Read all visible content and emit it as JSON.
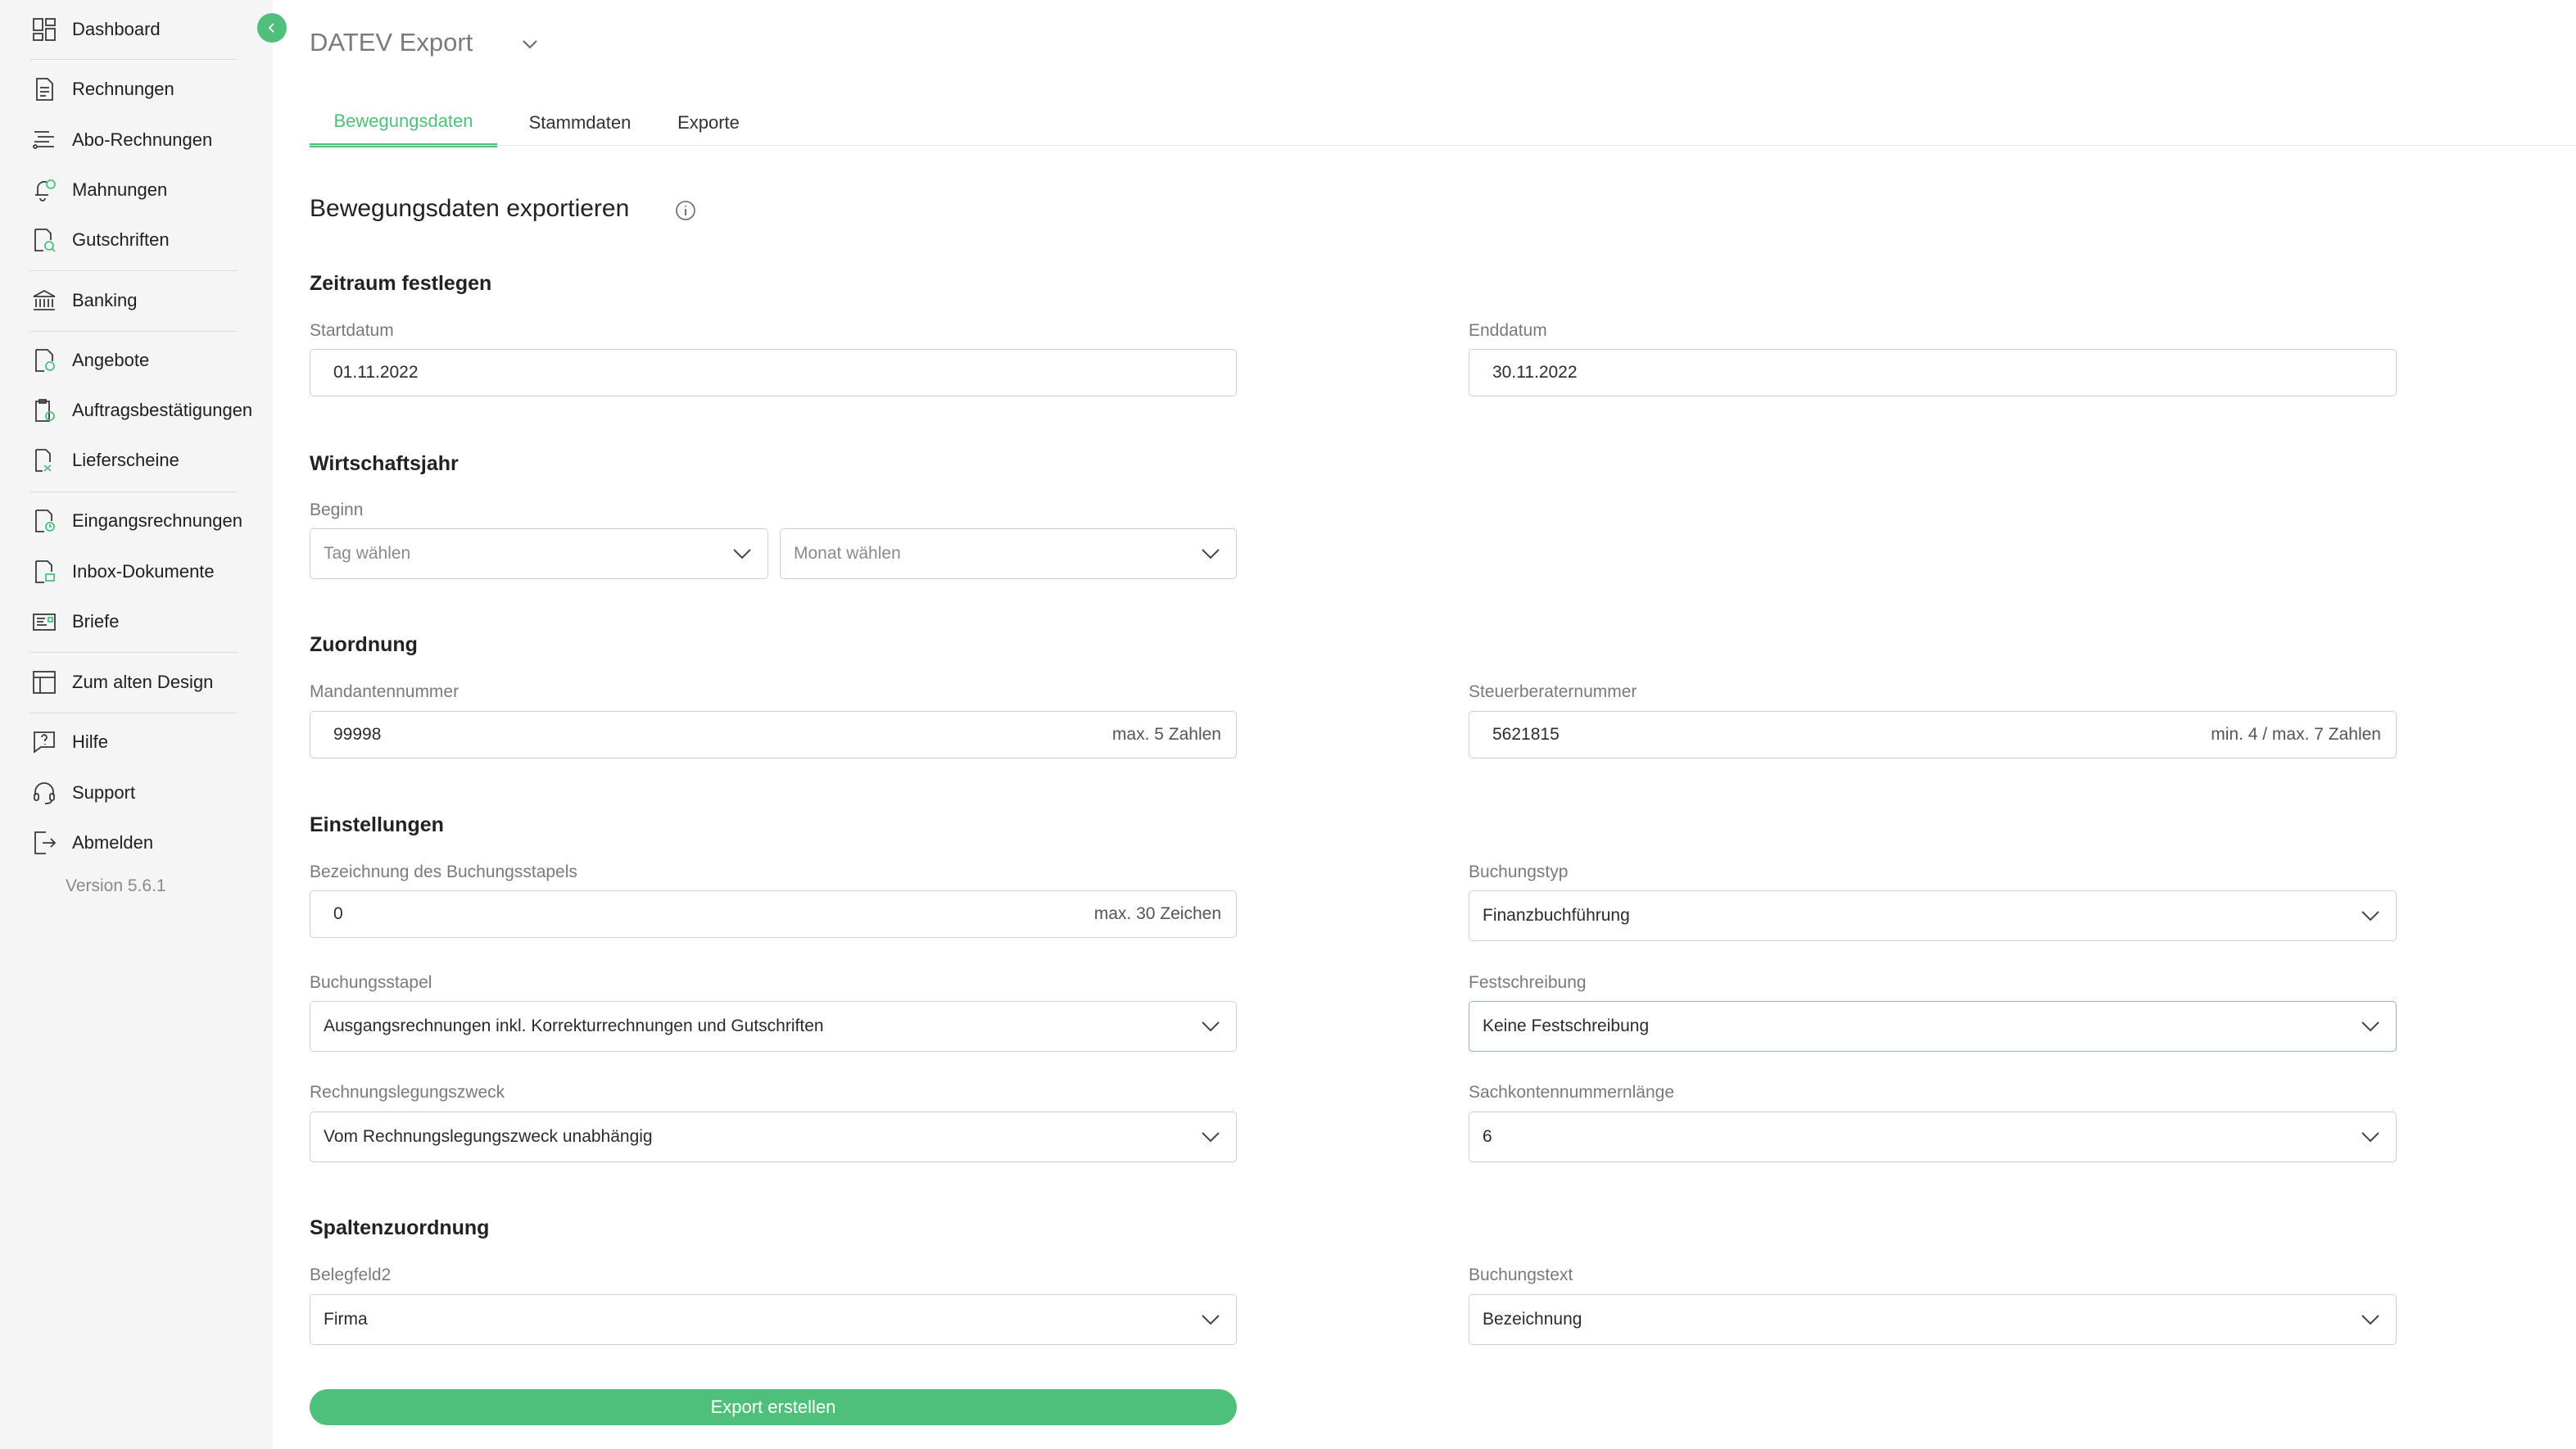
{
  "sidebar": {
    "items": [
      {
        "label": "Dashboard",
        "icon": "dashboard-icon"
      },
      {
        "label": "Rechnungen",
        "icon": "invoice-icon"
      },
      {
        "label": "Abo-Rechnungen",
        "icon": "subscription-invoice-icon"
      },
      {
        "label": "Mahnungen",
        "icon": "reminder-icon"
      },
      {
        "label": "Gutschriften",
        "icon": "credit-note-icon"
      },
      {
        "label": "Banking",
        "icon": "bank-icon"
      },
      {
        "label": "Angebote",
        "icon": "offer-icon"
      },
      {
        "label": "Auftragsbestätigungen",
        "icon": "order-confirmation-icon"
      },
      {
        "label": "Lieferscheine",
        "icon": "delivery-note-icon"
      },
      {
        "label": "Eingangsrechnungen",
        "icon": "incoming-invoice-icon"
      },
      {
        "label": "Inbox-Dokumente",
        "icon": "inbox-documents-icon"
      },
      {
        "label": "Briefe",
        "icon": "letter-icon"
      },
      {
        "label": "Zum alten Design",
        "icon": "layout-icon"
      },
      {
        "label": "Hilfe",
        "icon": "help-icon"
      },
      {
        "label": "Support",
        "icon": "headset-icon"
      },
      {
        "label": "Abmelden",
        "icon": "logout-icon"
      }
    ],
    "version": "Version 5.6.1"
  },
  "header": {
    "title": "DATEV Export",
    "tabs": [
      {
        "label": "Bewegungsdaten",
        "active": true
      },
      {
        "label": "Stammdaten",
        "active": false
      },
      {
        "label": "Exporte",
        "active": false
      }
    ]
  },
  "form": {
    "heading": "Bewegungsdaten exportieren",
    "zeitraum": {
      "title": "Zeitraum festlegen",
      "start_label": "Startdatum",
      "start_value": "01.11.2022",
      "end_label": "Enddatum",
      "end_value": "30.11.2022"
    },
    "wirtschaftsjahr": {
      "title": "Wirtschaftsjahr",
      "beginn_label": "Beginn",
      "tag_placeholder": "Tag wählen",
      "monat_placeholder": "Monat wählen"
    },
    "zuordnung": {
      "title": "Zuordnung",
      "mandant_label": "Mandantennummer",
      "mandant_value": "99998",
      "mandant_hint": "max. 5 Zahlen",
      "berater_label": "Steuerberaternummer",
      "berater_value": "5621815",
      "berater_hint": "min. 4 / max. 7 Zahlen"
    },
    "einstellungen": {
      "title": "Einstellungen",
      "stapel_bez_label": "Bezeichnung des Buchungsstapels",
      "stapel_bez_value": "0",
      "stapel_bez_hint": "max. 30 Zeichen",
      "buchungstyp_label": "Buchungstyp",
      "buchungstyp_value": "Finanzbuchführung",
      "stapel_label": "Buchungsstapel",
      "stapel_value": "Ausgangsrechnungen inkl. Korrekturrechnungen und Gutschriften",
      "fest_label": "Festschreibung",
      "fest_value": "Keine Festschreibung",
      "zweck_label": "Rechnungslegungszweck",
      "zweck_value": "Vom Rechnungslegungszweck unabhängig",
      "sachkonto_label": "Sachkontennummernlänge",
      "sachkonto_value": "6"
    },
    "spalten": {
      "title": "Spaltenzuordnung",
      "beleg_label": "Belegfeld2",
      "beleg_value": "Firma",
      "text_label": "Buchungstext",
      "text_value": "Bezeichnung"
    },
    "export_label": "Export erstellen"
  },
  "colors": {
    "accent": "#4fbf7c",
    "sidebar_bg": "#f5f5f5",
    "border": "#cfcfcf"
  }
}
